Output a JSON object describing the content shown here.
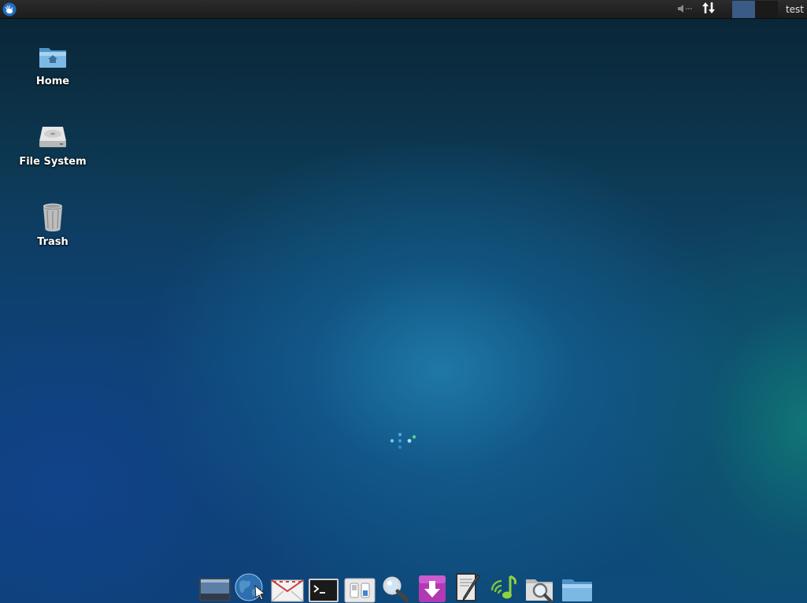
{
  "top_panel": {
    "user_label": "test",
    "workspaces": [
      {
        "active": true
      },
      {
        "active": false
      }
    ],
    "icons": {
      "menu": "xfce-mouse-icon",
      "volume": "volume-muted-icon",
      "network": "network-transfer-icon"
    }
  },
  "desktop_icons": [
    {
      "label": "Home",
      "icon": "home-folder-icon"
    },
    {
      "label": "File System",
      "icon": "hard-drive-icon"
    },
    {
      "label": "Trash",
      "icon": "trash-icon"
    }
  ],
  "dock": {
    "items": [
      {
        "icon": "show-desktop-icon"
      },
      {
        "icon": "web-browser-icon"
      },
      {
        "icon": "mail-icon"
      },
      {
        "icon": "terminal-icon"
      },
      {
        "icon": "settings-manager-icon"
      },
      {
        "icon": "app-finder-icon"
      },
      {
        "icon": "software-install-icon"
      },
      {
        "icon": "text-editor-icon"
      },
      {
        "icon": "music-player-icon"
      },
      {
        "icon": "file-search-icon"
      },
      {
        "icon": "file-manager-icon"
      }
    ]
  },
  "colors": {
    "panel": "#1f1f1f",
    "workspace_active": "#3a5b86",
    "accent_blue": "#1d7fb8"
  }
}
